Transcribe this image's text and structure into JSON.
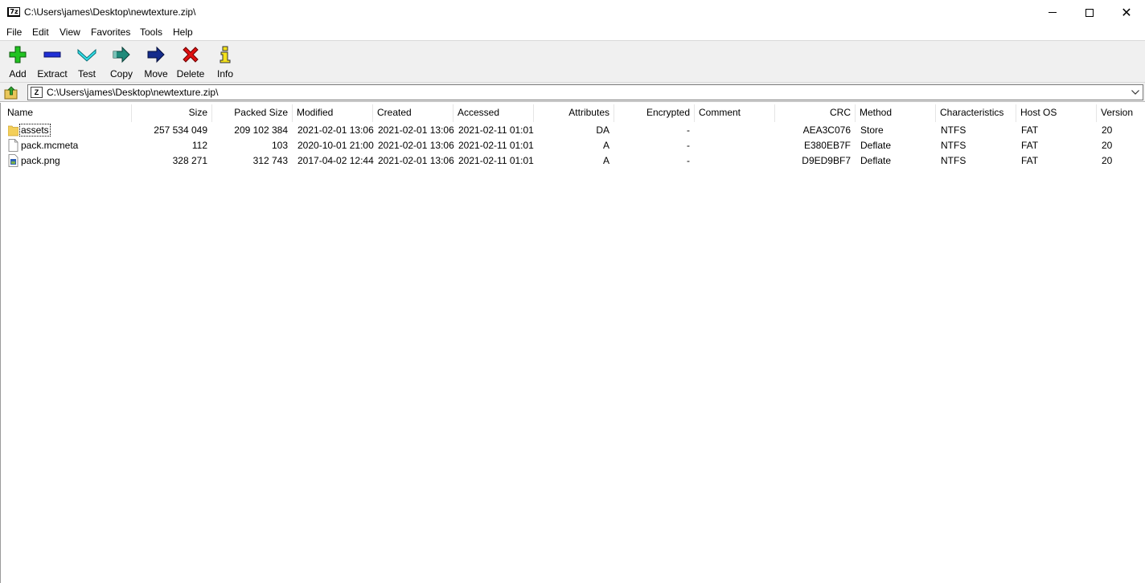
{
  "window": {
    "title": "C:\\Users\\james\\Desktop\\newtexture.zip\\",
    "app_icon_label": "7z"
  },
  "menu": [
    "File",
    "Edit",
    "View",
    "Favorites",
    "Tools",
    "Help"
  ],
  "toolbar": {
    "add": "Add",
    "extract": "Extract",
    "test": "Test",
    "copy": "Copy",
    "move": "Move",
    "delete": "Delete",
    "info": "Info"
  },
  "address": {
    "path": "C:\\Users\\james\\Desktop\\newtexture.zip\\"
  },
  "columns": [
    "Name",
    "Size",
    "Packed Size",
    "Modified",
    "Created",
    "Accessed",
    "Attributes",
    "Encrypted",
    "Comment",
    "CRC",
    "Method",
    "Characteristics",
    "Host OS",
    "Version"
  ],
  "rows": [
    {
      "name": "assets",
      "type": "folder",
      "size": "257 534 049",
      "packed": "209 102 384",
      "modified": "2021-02-01 13:06",
      "created": "2021-02-01 13:06",
      "accessed": "2021-02-11 01:01",
      "attributes": "DA",
      "encrypted": "-",
      "comment": "",
      "crc": "AEA3C076",
      "method": "Store",
      "characteristics": "NTFS",
      "host_os": "FAT",
      "version": "20"
    },
    {
      "name": "pack.mcmeta",
      "type": "file",
      "size": "112",
      "packed": "103",
      "modified": "2020-10-01 21:00",
      "created": "2021-02-01 13:06",
      "accessed": "2021-02-11 01:01",
      "attributes": "A",
      "encrypted": "-",
      "comment": "",
      "crc": "E380EB7F",
      "method": "Deflate",
      "characteristics": "NTFS",
      "host_os": "FAT",
      "version": "20"
    },
    {
      "name": "pack.png",
      "type": "image",
      "size": "328 271",
      "packed": "312 743",
      "modified": "2017-04-02 12:44",
      "created": "2021-02-01 13:06",
      "accessed": "2021-02-11 01:01",
      "attributes": "A",
      "encrypted": "-",
      "comment": "",
      "crc": "D9ED9BF7",
      "method": "Deflate",
      "characteristics": "NTFS",
      "host_os": "FAT",
      "version": "20"
    }
  ]
}
